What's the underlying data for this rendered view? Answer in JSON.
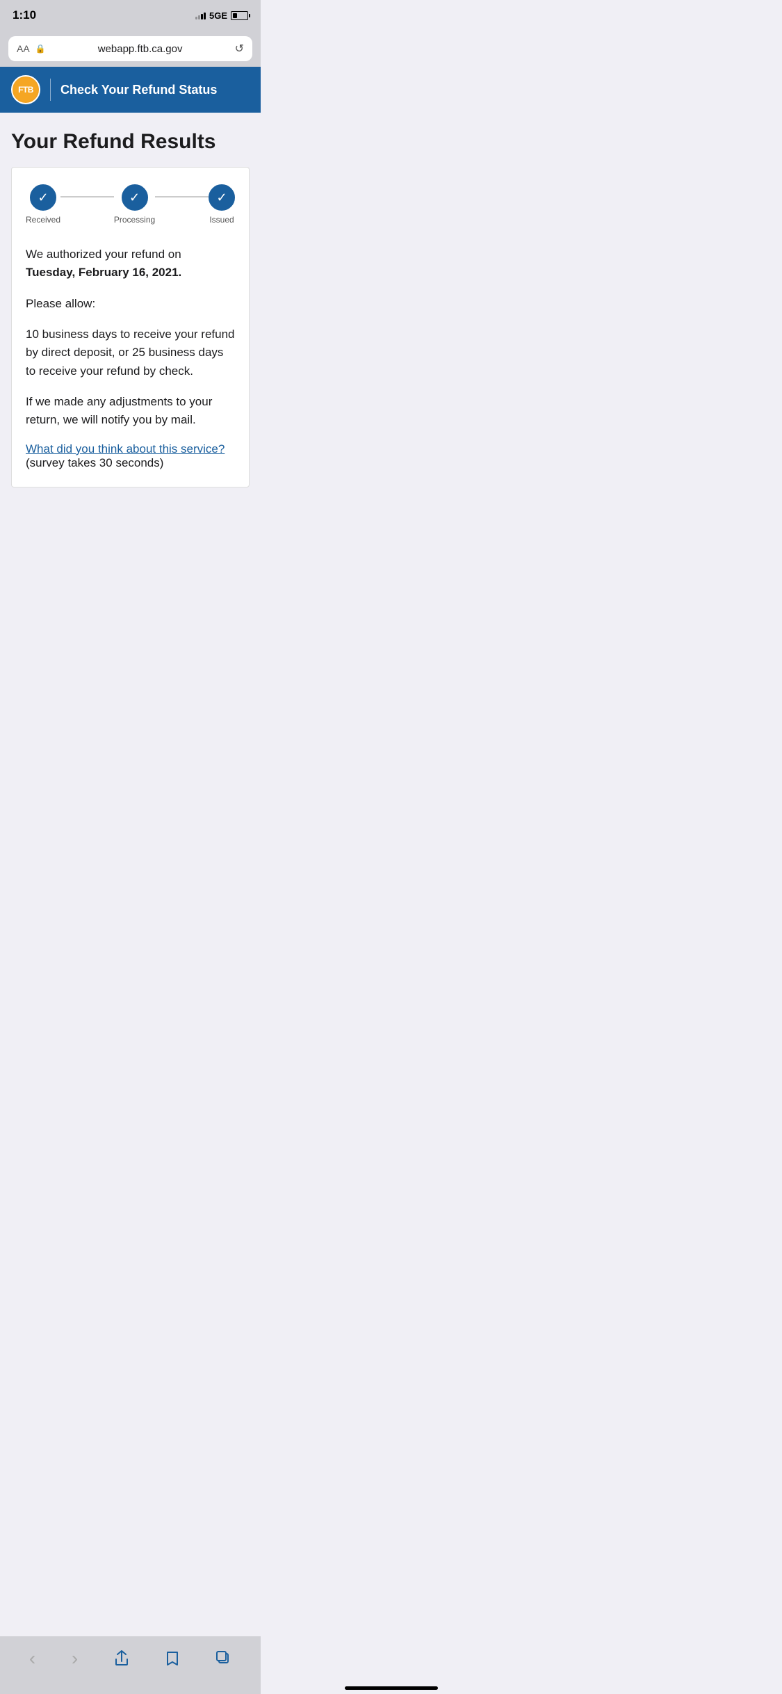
{
  "status_bar": {
    "time": "1:10",
    "network": "5GE"
  },
  "browser": {
    "aa_label": "AA",
    "url": "webapp.ftb.ca.gov",
    "refresh_icon": "↺"
  },
  "header": {
    "logo_text": "FTB",
    "title": "Check Your Refund Status"
  },
  "page": {
    "title": "Your Refund Results"
  },
  "progress": {
    "steps": [
      {
        "label": "Received",
        "active": true
      },
      {
        "label": "Processing",
        "active": true
      },
      {
        "label": "Issued",
        "active": true
      }
    ]
  },
  "content": {
    "auth_line1": "We authorized your refund on",
    "auth_line2": "Tuesday, February 16, 2021.",
    "allow_label": "Please allow:",
    "allow_detail": "10 business days to receive your refund by direct deposit, or 25 business days to receive your refund by check.",
    "adjust_note": "If we made any adjustments to your return, we will notify you by mail.",
    "survey_link_text": "What did you think about this service?",
    "survey_suffix": " (survey takes 30 seconds)"
  },
  "bottom_nav": {
    "back": "‹",
    "forward": "›",
    "share": "↑",
    "bookmarks": "📖",
    "tabs": "⧉"
  }
}
